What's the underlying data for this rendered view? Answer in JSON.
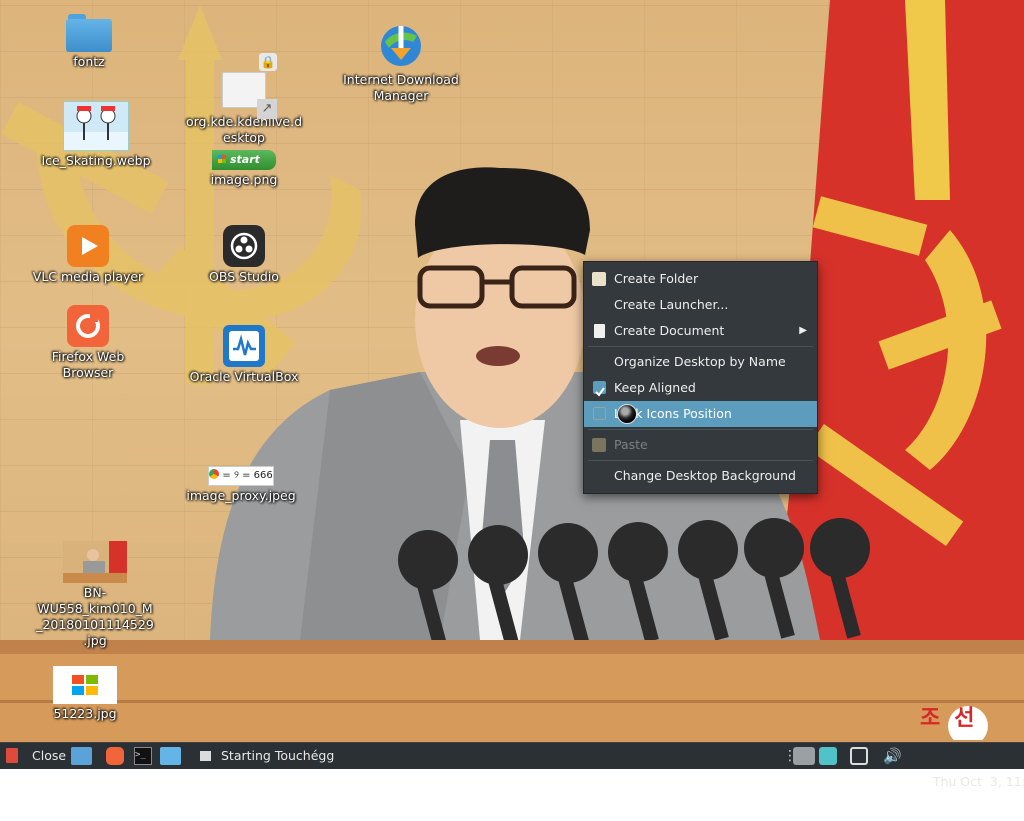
{
  "desktop": {
    "icons": [
      {
        "label": "fontz"
      },
      {
        "label": "Ice_Skating.webp"
      },
      {
        "label": "VLC media player"
      },
      {
        "label": "Firefox Web Browser"
      },
      {
        "label": "BN-WU558_kim010_M_20180101114529.jpg"
      },
      {
        "label": "51223.jpg"
      },
      {
        "label": "org.kde.kdenlive.desktop"
      },
      {
        "label": "image.png",
        "thumb_text": "start"
      },
      {
        "label": "OBS Studio"
      },
      {
        "label": "Oracle VirtualBox"
      },
      {
        "label": "image_proxy.jpeg",
        "thumb_text": "= ୨ = 666"
      },
      {
        "label": "Internet Download Manager"
      }
    ],
    "watermark": "조선"
  },
  "context_menu": {
    "items": [
      {
        "label": "Create Folder",
        "icon": "new-folder-icon"
      },
      {
        "label": "Create Launcher...",
        "icon": ""
      },
      {
        "label": "Create Document",
        "icon": "new-document-icon",
        "submenu_arrow": "▶"
      },
      {
        "label": "Organize Desktop by Name"
      },
      {
        "label": "Keep Aligned",
        "checked": true
      },
      {
        "label": "Lock Icons Position",
        "checked": false,
        "highlighted": true
      },
      {
        "label": "Paste",
        "disabled": true,
        "icon": "paste-icon"
      },
      {
        "label": "Change Desktop Background"
      }
    ]
  },
  "taskbar": {
    "close_label": "Close",
    "task_label": "Starting Touchégg",
    "clock": "Thu Oct  3, 11:14"
  },
  "colors": {
    "menu_bg": "#33393c",
    "menu_highlight": "#5c9dbd",
    "taskbar_bg": "#2b3034"
  }
}
